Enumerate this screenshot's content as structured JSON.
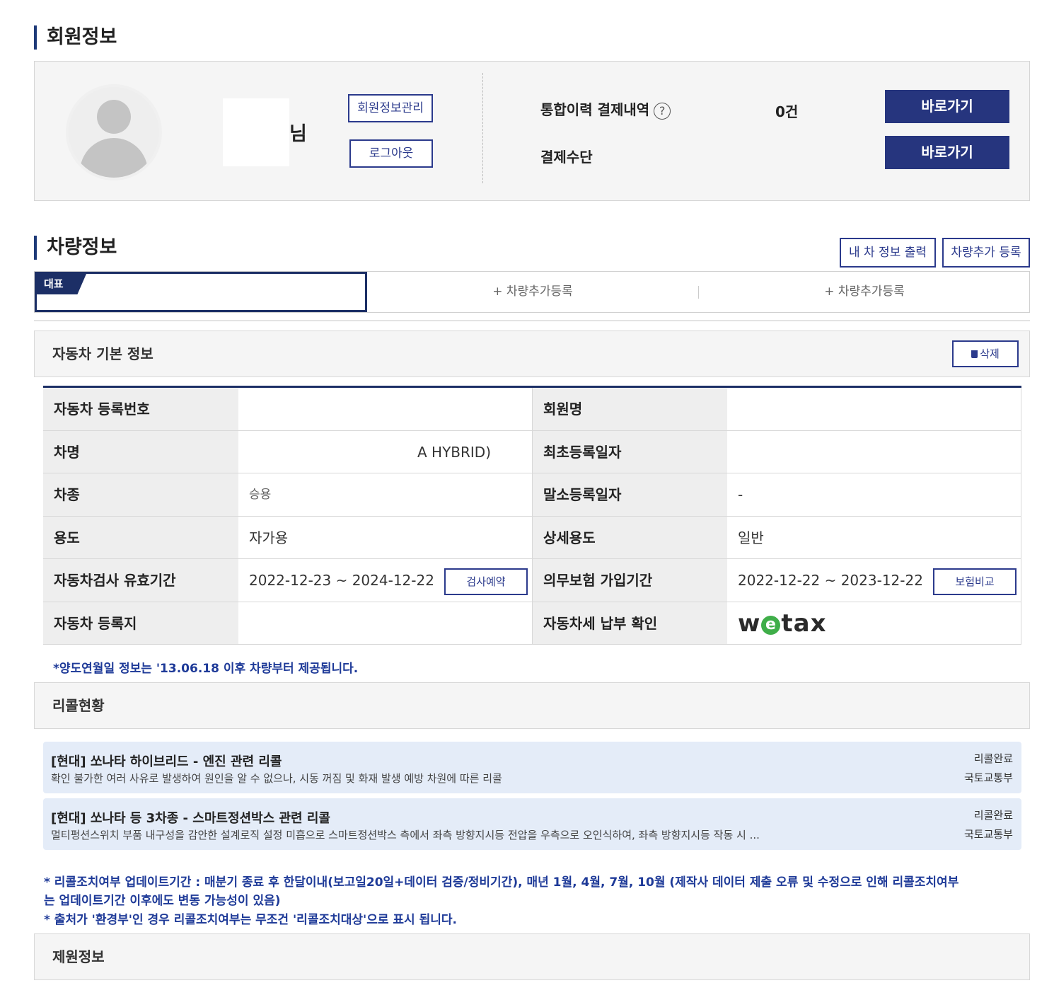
{
  "member_section": {
    "title": "회원정보",
    "name_suffix": "님",
    "manage_button": "회원정보관리",
    "logout_button": "로그아웃",
    "history_label": "통합이력 결제내역",
    "help_icon": "?",
    "history_count": "0건",
    "payment_label": "결제수단",
    "go_button_1": "바로가기",
    "go_button_2": "바로가기"
  },
  "vehicle_section": {
    "title": "차량정보",
    "print_button": "내 차 정보 출력",
    "add_button": "차량추가 등록",
    "tabs": {
      "active_badge": "대표",
      "add_tab_1": "+ 차량추가등록",
      "add_tab_2": "+ 차량추가등록"
    },
    "basic_info": {
      "title": "자동차 기본 정보",
      "delete_button": "삭제"
    },
    "table": {
      "row1": {
        "label_left": "자동차 등록번호",
        "value_left": "",
        "label_right": "회원명",
        "value_right": ""
      },
      "row2": {
        "label_left": "차명",
        "value_left": "A HYBRID)",
        "label_right": "최초등록일자",
        "value_right": ""
      },
      "row3": {
        "label_left": "차종",
        "value_left": "승용",
        "label_right": "말소등록일자",
        "value_right": "-"
      },
      "row4": {
        "label_left": "용도",
        "value_left": "자가용",
        "label_right": "상세용도",
        "value_right": "일반"
      },
      "row5": {
        "label_left": "자동차검사 유효기간",
        "value_left": "2022-12-23 ~ 2024-12-22",
        "button_left": "검사예약",
        "label_right": "의무보험 가입기간",
        "value_right": "2022-12-22 ~ 2023-12-22",
        "button_right": "보험비교"
      },
      "row6": {
        "label_left": "자동차 등록지",
        "value_left": "",
        "label_right": "자동차세 납부 확인",
        "logo_w": "w",
        "logo_e": "e",
        "logo_tax": "tax"
      }
    },
    "transfer_note": "*양도연월일 정보는 '13.06.18 이후 차량부터 제공됩니다."
  },
  "recall_section": {
    "title": "리콜현황",
    "items": [
      {
        "title": "[현대] 쏘나타 하이브리드 - 엔진 관련 리콜",
        "desc": "확인 불가한 여러 사유로 발생하여 원인을 알 수 없으나, 시동 꺼짐 및 화재 발생 예방 차원에 따른 리콜",
        "status": "리콜완료",
        "source": "국토교통부"
      },
      {
        "title": "[현대] 쏘나타 등 3차종 - 스마트정션박스 관련 리콜",
        "desc": "멀티펑션스위치 부품 내구성을 감안한 설계로직 설정 미흡으로 스마트정션박스 측에서 좌측 방향지시등 전압을 우측으로 오인식하여, 좌측 방향지시등 작동 시 ...",
        "status": "리콜완료",
        "source": "국토교통부"
      }
    ],
    "note_line1": "* 리콜조치여부 업데이트기간 : 매분기 종료 후 한달이내(보고일20일+데이터 검증/정비기간), 매년 1월, 4월, 7월, 10월 (제작사 데이터 제출 오류 및 수정으로 인해 리콜조치여부",
    "note_line2": "는 업데이트기간 이후에도 변동 가능성이 있음)",
    "note_line3": "* 출처가 '환경부'인 경우 리콜조치여부는 무조건 '리콜조치대상'으로 표시 됩니다."
  },
  "spec_section": {
    "title": "제원정보"
  }
}
